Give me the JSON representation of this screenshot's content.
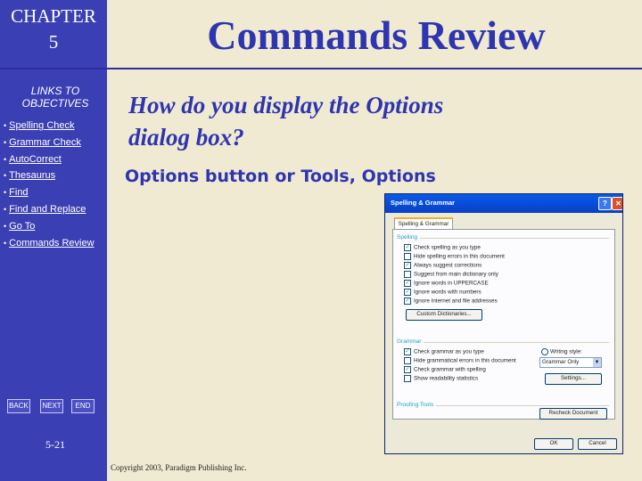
{
  "sidebar": {
    "chapter_label": "CHAPTER",
    "chapter_number": "5",
    "links_title_line1": "LINKS TO",
    "links_title_line2": "OBJECTIVES",
    "links": [
      {
        "label": "Spelling Check"
      },
      {
        "label": "Grammar Check"
      },
      {
        "label": "AutoCorrect"
      },
      {
        "label": "Thesaurus"
      },
      {
        "label": "Find"
      },
      {
        "label": "Find and Replace"
      },
      {
        "label": "Go To"
      },
      {
        "label": "Commands Review"
      }
    ],
    "nav": {
      "back": "BACK",
      "next": "NEXT",
      "end": "END"
    },
    "page_number": "5-21"
  },
  "slide": {
    "title": "Commands Review",
    "question_line1": "How do you display the Options",
    "question_line2": "dialog box?",
    "answer": "Options button or Tools, Options",
    "copyright": "Copyright 2003, Paradigm Publishing Inc."
  },
  "dialog": {
    "title": "Spelling & Grammar",
    "help_icon": "?",
    "close_icon": "✕",
    "tab": "Spelling & Grammar",
    "spelling_group": "Spelling",
    "spelling_options": [
      {
        "label": "Check spelling as you type",
        "checked": true
      },
      {
        "label": "Hide spelling errors in this document",
        "checked": false
      },
      {
        "label": "Always suggest corrections",
        "checked": true
      },
      {
        "label": "Suggest from main dictionary only",
        "checked": false
      },
      {
        "label": "Ignore words in UPPERCASE",
        "checked": true
      },
      {
        "label": "Ignore words with numbers",
        "checked": true
      },
      {
        "label": "Ignore Internet and file addresses",
        "checked": true
      }
    ],
    "custom_dictionaries_button": "Custom Dictionaries...",
    "grammar_group": "Grammar",
    "grammar_options": [
      {
        "label": "Check grammar as you type",
        "checked": true
      },
      {
        "label": "Hide grammatical errors in this document",
        "checked": false
      },
      {
        "label": "Check grammar with spelling",
        "checked": true
      },
      {
        "label": "Show readability statistics",
        "checked": false
      }
    ],
    "writing_style_label": "Writing style:",
    "writing_style_value": "Grammar Only",
    "settings_button": "Settings...",
    "proofing_group": "Proofing Tools",
    "recheck_button": "Recheck Document",
    "ok_button": "OK",
    "cancel_button": "Cancel"
  },
  "colors": {
    "sidebar_bg": "#3b3fb4",
    "slide_bg": "#f1ead2",
    "title_blue": "#2e35b0",
    "dialog_titlebar": "#0a5ae8"
  }
}
